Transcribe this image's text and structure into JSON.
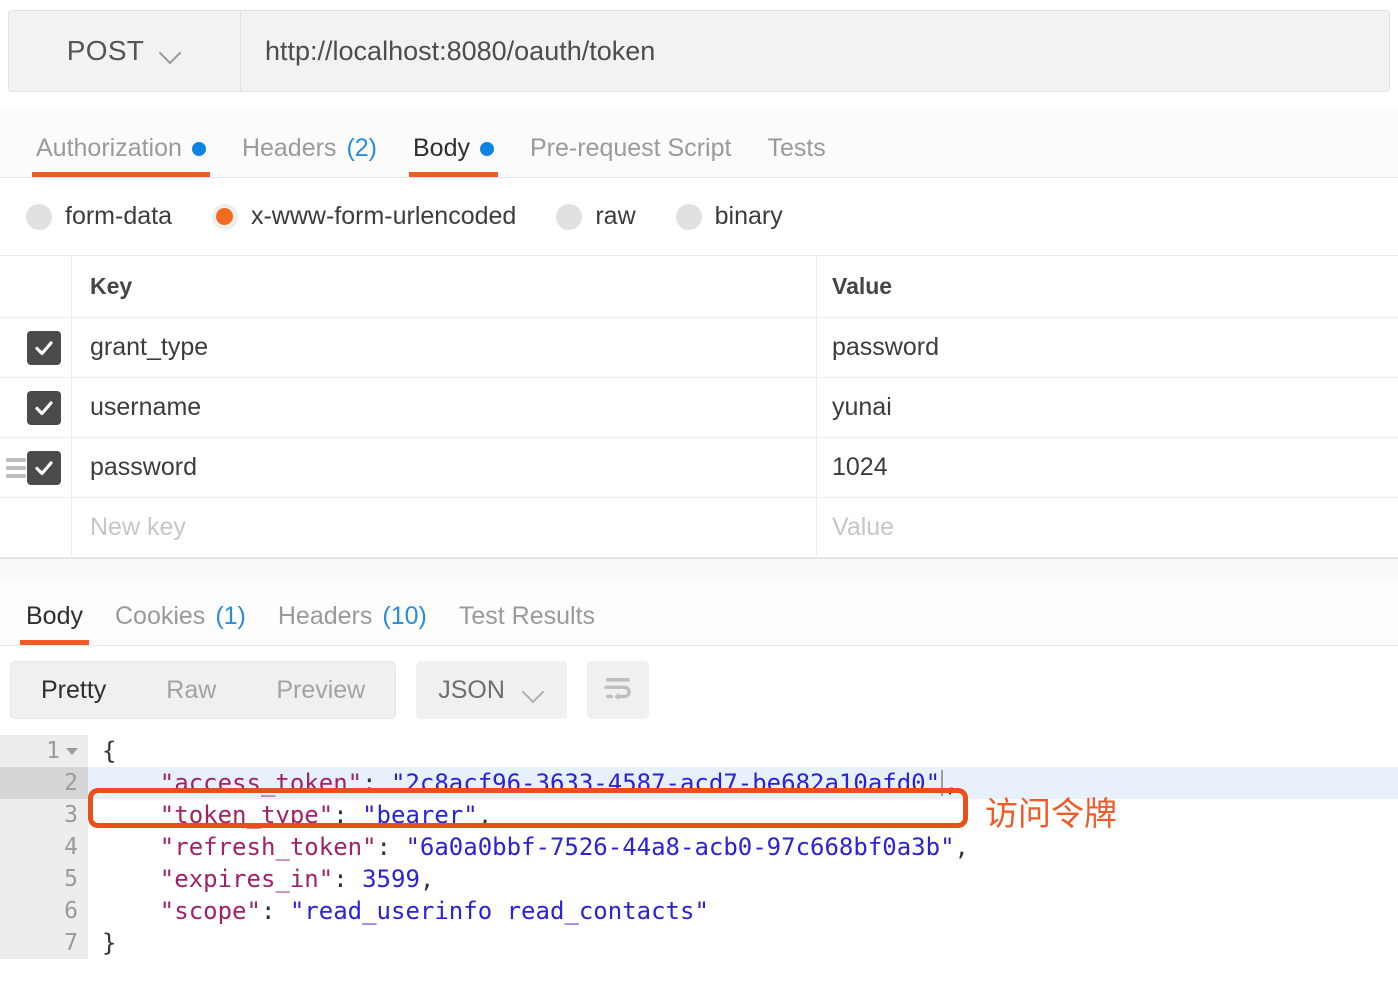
{
  "request": {
    "method": "POST",
    "url": "http://localhost:8080/oauth/token",
    "method_chevron_icon": "chevron-down-icon",
    "tabs": [
      {
        "label": "Authorization",
        "badge": "",
        "dot": true,
        "active": false
      },
      {
        "label": "Headers",
        "badge": "(2)",
        "dot": false,
        "active": false
      },
      {
        "label": "Body",
        "badge": "",
        "dot": true,
        "active": true
      },
      {
        "label": "Pre-request Script",
        "badge": "",
        "dot": false,
        "active": false
      },
      {
        "label": "Tests",
        "badge": "",
        "dot": false,
        "active": false
      }
    ],
    "body_types": [
      {
        "label": "form-data",
        "selected": false
      },
      {
        "label": "x-www-form-urlencoded",
        "selected": true
      },
      {
        "label": "raw",
        "selected": false
      },
      {
        "label": "binary",
        "selected": false
      }
    ],
    "table": {
      "columns": [
        "Key",
        "Value"
      ],
      "rows": [
        {
          "checked": true,
          "key": "grant_type",
          "value": "password",
          "drag_handle": false
        },
        {
          "checked": true,
          "key": "username",
          "value": "yunai",
          "drag_handle": false
        },
        {
          "checked": true,
          "key": "password",
          "value": "1024",
          "drag_handle": true
        }
      ],
      "new_row": {
        "key_placeholder": "New key",
        "value_placeholder": "Value"
      }
    }
  },
  "response": {
    "tabs": [
      {
        "label": "Body",
        "badge": "",
        "active": true
      },
      {
        "label": "Cookies",
        "badge": "(1)",
        "active": false
      },
      {
        "label": "Headers",
        "badge": "(10)",
        "active": false
      },
      {
        "label": "Test Results",
        "badge": "",
        "active": false
      }
    ],
    "toolbar": {
      "view_modes": [
        {
          "label": "Pretty",
          "active": true
        },
        {
          "label": "Raw",
          "active": false
        },
        {
          "label": "Preview",
          "active": false
        }
      ],
      "format": "JSON",
      "format_chevron_icon": "chevron-down-icon",
      "wrap_button_icon": "word-wrap-icon"
    },
    "code": {
      "lines": [
        {
          "num": "1",
          "foldable": true,
          "highlight": false,
          "tokens": [
            {
              "t": "p",
              "v": "{"
            }
          ]
        },
        {
          "num": "2",
          "foldable": false,
          "highlight": true,
          "tokens": [
            {
              "t": "p",
              "v": "    "
            },
            {
              "t": "k",
              "v": "\"access_token\""
            },
            {
              "t": "p",
              "v": ": "
            },
            {
              "t": "s",
              "v": "\"2c8acf96-3633-4587-acd7-be682a10afd0\""
            },
            {
              "t": "p",
              "v": ","
            }
          ]
        },
        {
          "num": "3",
          "foldable": false,
          "highlight": false,
          "tokens": [
            {
              "t": "p",
              "v": "    "
            },
            {
              "t": "k",
              "v": "\"token_type\""
            },
            {
              "t": "p",
              "v": ": "
            },
            {
              "t": "s",
              "v": "\"bearer\""
            },
            {
              "t": "p",
              "v": ","
            }
          ]
        },
        {
          "num": "4",
          "foldable": false,
          "highlight": false,
          "tokens": [
            {
              "t": "p",
              "v": "    "
            },
            {
              "t": "k",
              "v": "\"refresh_token\""
            },
            {
              "t": "p",
              "v": ": "
            },
            {
              "t": "s",
              "v": "\"6a0a0bbf-7526-44a8-acb0-97c668bf0a3b\""
            },
            {
              "t": "p",
              "v": ","
            }
          ]
        },
        {
          "num": "5",
          "foldable": false,
          "highlight": false,
          "tokens": [
            {
              "t": "p",
              "v": "    "
            },
            {
              "t": "k",
              "v": "\"expires_in\""
            },
            {
              "t": "p",
              "v": ": "
            },
            {
              "t": "n",
              "v": "3599"
            },
            {
              "t": "p",
              "v": ","
            }
          ]
        },
        {
          "num": "6",
          "foldable": false,
          "highlight": false,
          "tokens": [
            {
              "t": "p",
              "v": "    "
            },
            {
              "t": "k",
              "v": "\"scope\""
            },
            {
              "t": "p",
              "v": ": "
            },
            {
              "t": "s",
              "v": "\"read_userinfo read_contacts\""
            }
          ]
        },
        {
          "num": "7",
          "foldable": false,
          "highlight": false,
          "tokens": [
            {
              "t": "p",
              "v": "}"
            }
          ]
        }
      ]
    }
  },
  "annotation": {
    "text": "访问令牌",
    "color": "#ee5a28"
  },
  "colors": {
    "accent_orange": "#ef5b25",
    "dot_blue": "#0c83e2",
    "count_blue": "#2a8cdd",
    "highlight_row": "#e7f0fb",
    "json_key": "#a0226b",
    "json_string": "#2a22d8"
  }
}
